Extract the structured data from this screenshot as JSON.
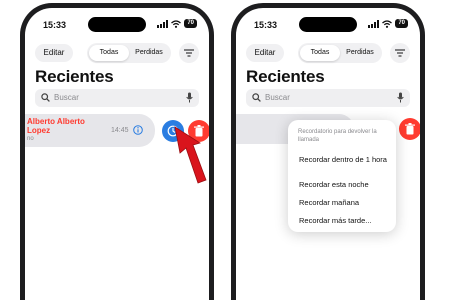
{
  "status": {
    "time": "15:33",
    "battery": "70"
  },
  "toolbar": {
    "edit_label": "Editar",
    "segments": [
      "Todas",
      "Perdidas"
    ]
  },
  "page": {
    "title": "Recientes"
  },
  "search": {
    "placeholder": "Buscar"
  },
  "call": {
    "name": "Alberto Alberto\nLopez",
    "subtitle": "no",
    "time": "14:45"
  },
  "reminder_menu": {
    "header": "Recordatorio para devolver la llamada",
    "items": [
      "Recordar dentro de 1 hora",
      "Recordar esta noche",
      "Recordar mañana",
      "Recordar más tarde..."
    ]
  },
  "colors": {
    "missed_call": "#ff3b30",
    "remind_button": "#2a7de1",
    "delete_button": "#ff3b30",
    "arrow": "#d9141c"
  },
  "icons": {
    "filter": "filter-icon",
    "search": "search-icon",
    "mic": "mic-icon",
    "info": "info-icon",
    "reminder": "clock-icon",
    "delete": "trash-icon"
  }
}
